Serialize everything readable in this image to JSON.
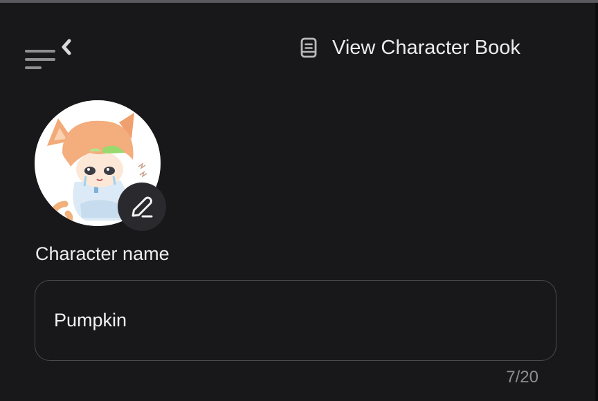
{
  "header": {
    "book_link_label": "View Character Book"
  },
  "form": {
    "name_label": "Character name",
    "name_value": "Pumpkin",
    "name_counter": "7/20"
  },
  "icons": {
    "sidebar_toggle": "collapse-sidebar-icon",
    "book": "book-icon",
    "edit": "pencil-icon"
  },
  "colors": {
    "background": "#18181b",
    "text": "#ececee",
    "muted": "#8e8e93",
    "border": "#4a4a4f"
  }
}
